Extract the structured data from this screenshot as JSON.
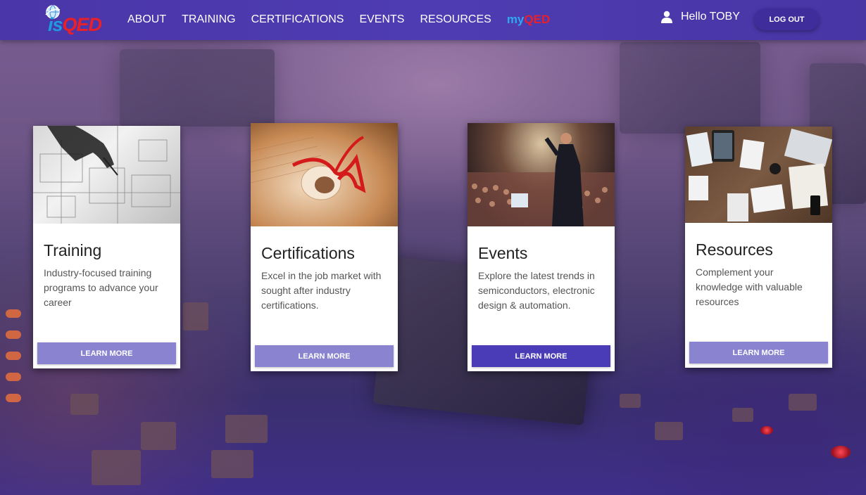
{
  "brand": {
    "logo_is": "is",
    "logo_qed": "QED"
  },
  "nav": {
    "items": [
      {
        "label": "ABOUT"
      },
      {
        "label": "TRAINING"
      },
      {
        "label": "CERTIFICATIONS"
      },
      {
        "label": "EVENTS"
      },
      {
        "label": "RESOURCES"
      }
    ],
    "myqed_my": "my",
    "myqed_qed": "QED"
  },
  "user": {
    "greeting": "Hello TOBY",
    "icon": "user-icon",
    "logout_label": "LOG OUT"
  },
  "cards": [
    {
      "title": "Training",
      "description": "Industry-focused training programs to advance your career",
      "button": "LEARN MORE",
      "image": "blueprint-hand-image"
    },
    {
      "title": "Certifications",
      "description": "Excel in the job market with sought after industry certifications.",
      "button": "LEARN MORE",
      "image": "diploma-ribbon-image"
    },
    {
      "title": "Events",
      "description": "Explore the latest trends in semiconductors, electronic design & automation.",
      "button": "LEARN MORE",
      "image": "conference-speaker-image"
    },
    {
      "title": "Resources",
      "description": "Complement your knowledge with valuable resources",
      "button": "LEARN MORE",
      "image": "desk-devices-image"
    }
  ],
  "colors": {
    "navbar": "#4e3cb3",
    "button": "#8a83cf",
    "button_active": "#4a3cb6",
    "brand_blue": "#1e9ae0",
    "brand_red": "#e8202a"
  }
}
